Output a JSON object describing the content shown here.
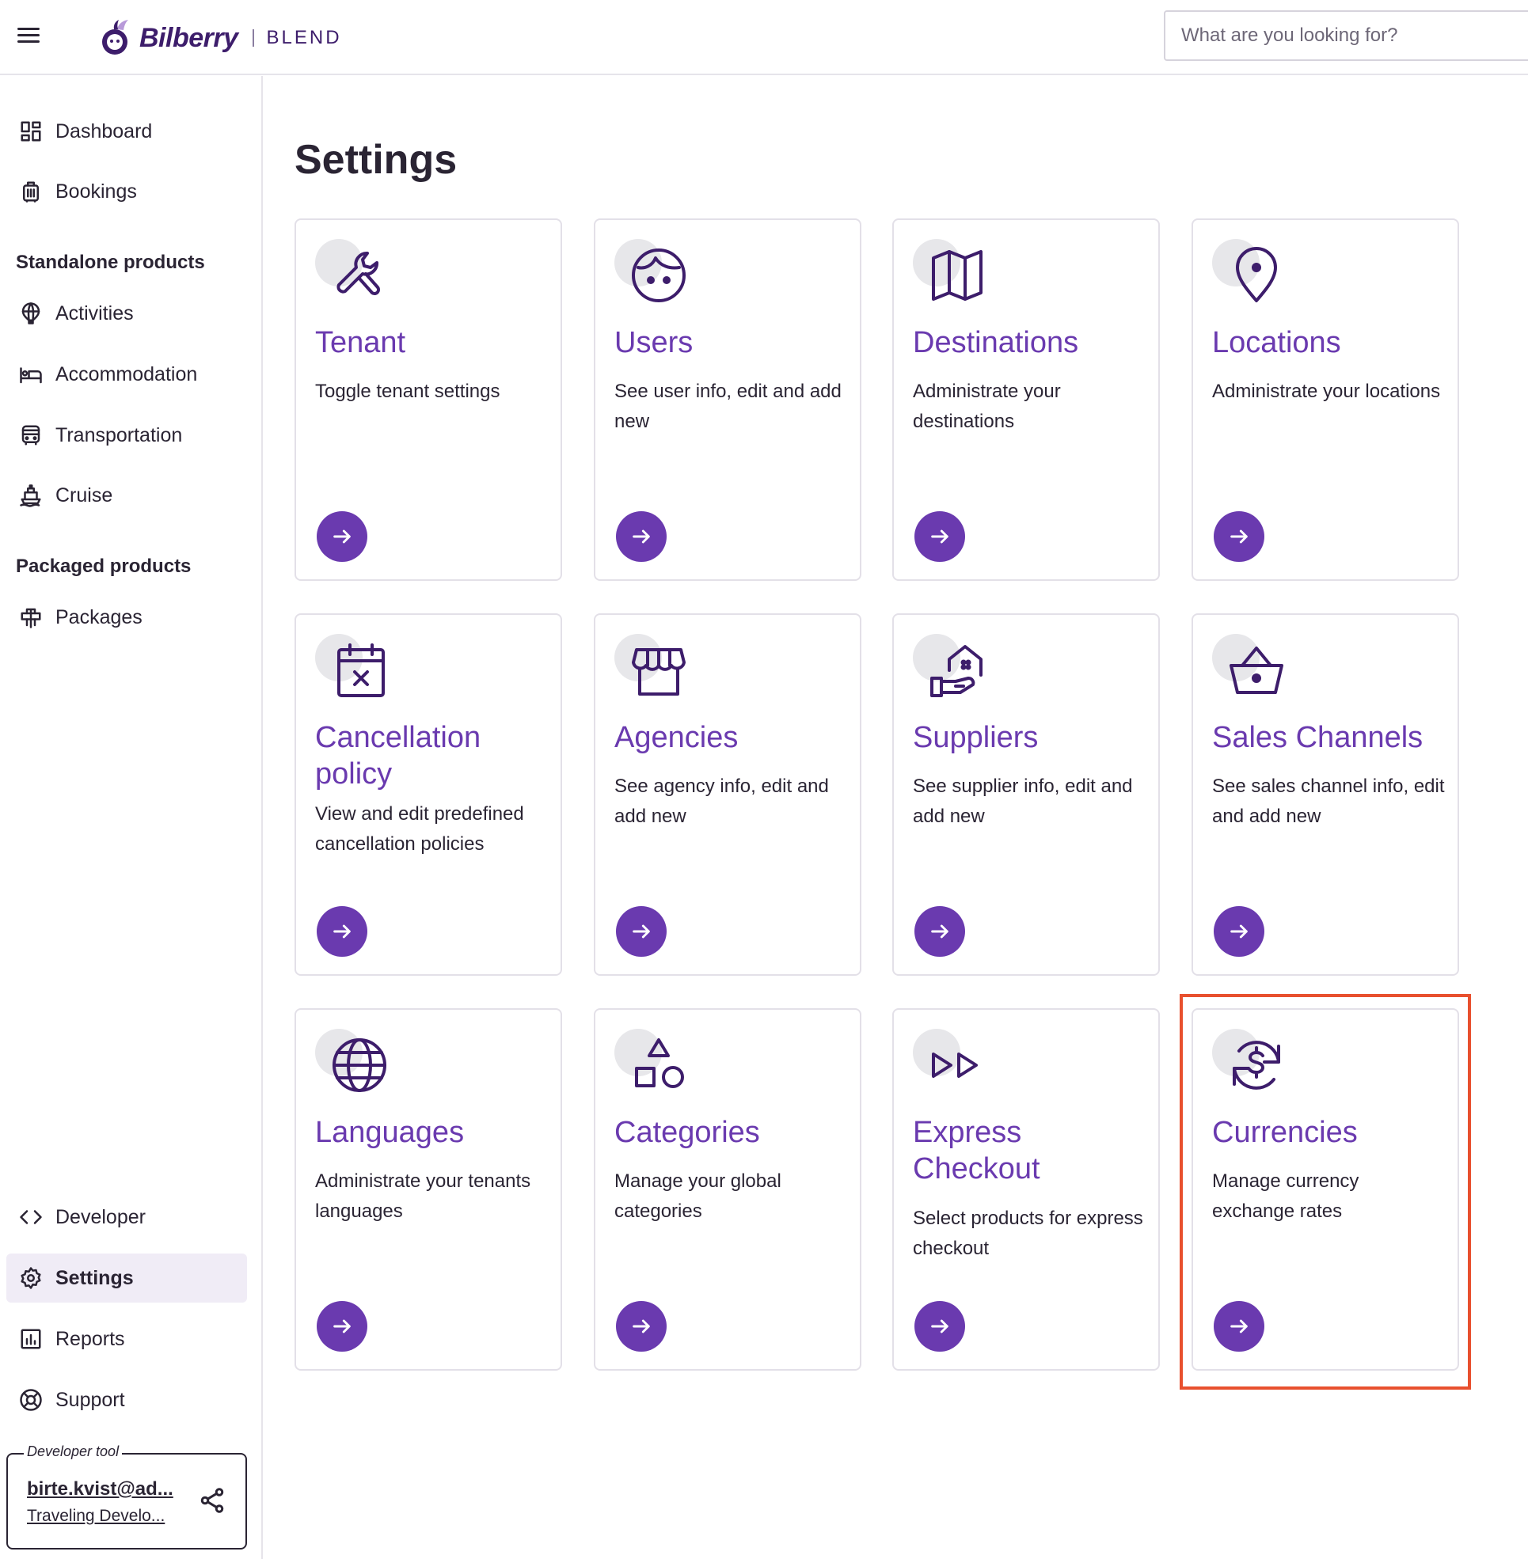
{
  "header": {
    "brand_name": "Bilberry",
    "product_name": "BLEND",
    "search_placeholder": "What are you looking for?"
  },
  "sidebar": {
    "items_top": [
      {
        "label": "Dashboard",
        "icon": "dashboard-icon"
      },
      {
        "label": "Bookings",
        "icon": "luggage-icon"
      }
    ],
    "standalone_heading": "Standalone products",
    "standalone_items": [
      {
        "label": "Activities",
        "icon": "hot-air-balloon-icon"
      },
      {
        "label": "Accommodation",
        "icon": "bed-icon"
      },
      {
        "label": "Transportation",
        "icon": "bus-icon"
      },
      {
        "label": "Cruise",
        "icon": "ship-icon"
      }
    ],
    "packaged_heading": "Packaged products",
    "packaged_items": [
      {
        "label": "Packages",
        "icon": "package-icon"
      }
    ],
    "items_bottom": [
      {
        "label": "Developer",
        "icon": "code-icon"
      },
      {
        "label": "Settings",
        "icon": "gear-icon",
        "active": true
      },
      {
        "label": "Reports",
        "icon": "chart-icon"
      },
      {
        "label": "Support",
        "icon": "lifebuoy-icon"
      }
    ],
    "devtool": {
      "legend": "Developer tool",
      "email": "birte.kvist@ad...",
      "org": "Traveling Develo..."
    }
  },
  "main": {
    "title": "Settings",
    "cards": [
      {
        "title": "Tenant",
        "description": "Toggle tenant settings",
        "icon": "wrench-icon"
      },
      {
        "title": "Users",
        "description": "See user info, edit and add new",
        "icon": "face-icon"
      },
      {
        "title": "Destinations",
        "description": "Administrate your destinations",
        "icon": "map-icon"
      },
      {
        "title": "Locations",
        "description": "Administrate your locations",
        "icon": "map-pin-icon"
      },
      {
        "title": "Cancellation policy",
        "description": "View and edit predefined cancellation policies",
        "icon": "calendar-x-icon"
      },
      {
        "title": "Agencies",
        "description": "See agency info, edit and add new",
        "icon": "storefront-icon"
      },
      {
        "title": "Suppliers",
        "description": "See supplier info, edit and add new",
        "icon": "hand-house-icon"
      },
      {
        "title": "Sales Channels",
        "description": "See sales channel info, edit and add new",
        "icon": "basket-icon"
      },
      {
        "title": "Languages",
        "description": "Administrate your tenants languages",
        "icon": "globe-icon"
      },
      {
        "title": "Categories",
        "description": "Manage your global categories",
        "icon": "shapes-icon"
      },
      {
        "title": "Express Checkout",
        "description": "Select products for express checkout",
        "icon": "fast-forward-icon"
      },
      {
        "title": "Currencies",
        "description": "Manage currency exchange rates",
        "icon": "currency-exchange-icon",
        "highlighted": true
      }
    ]
  },
  "colors": {
    "accent": "#6a3aaf",
    "brand_dark": "#3d1d6b",
    "highlight": "#e8502e",
    "active_nav_bg": "#f0ecf6"
  }
}
